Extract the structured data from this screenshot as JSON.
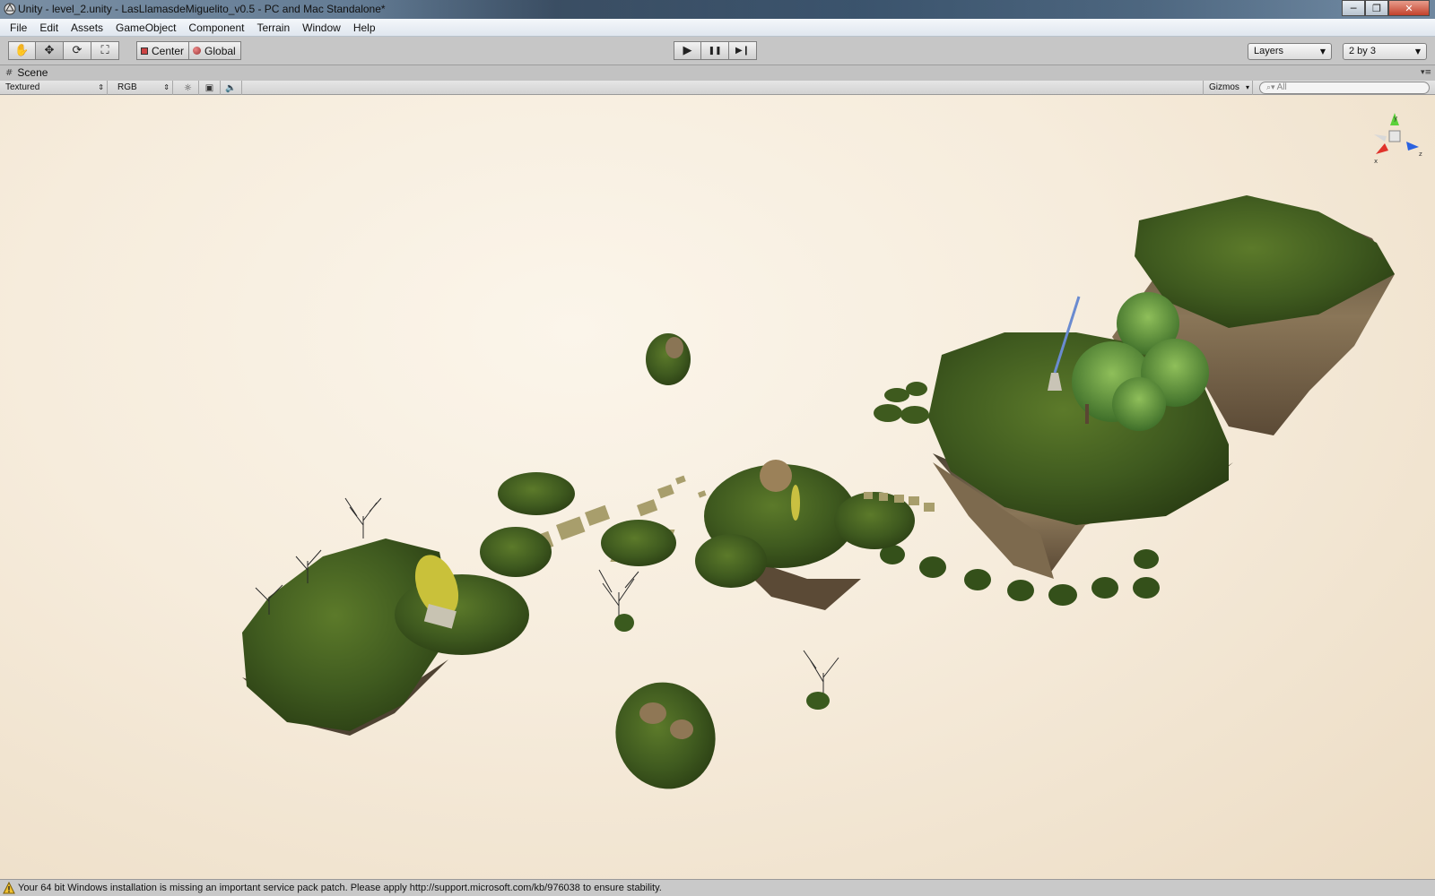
{
  "window": {
    "title": "Unity - level_2.unity - LasLlamasdeMiguelito_v0.5 - PC and Mac Standalone*",
    "minimize_glyph": "─",
    "restore_glyph": "❐",
    "close_glyph": "✕"
  },
  "menu": {
    "items": [
      "File",
      "Edit",
      "Assets",
      "GameObject",
      "Component",
      "Terrain",
      "Window",
      "Help"
    ]
  },
  "toolbar": {
    "tools": [
      {
        "name": "hand-tool",
        "icon": "hand-icon",
        "glyph": "✋",
        "active": false
      },
      {
        "name": "move-tool",
        "icon": "move-icon",
        "glyph": "✥",
        "active": true
      },
      {
        "name": "rotate-tool",
        "icon": "rotate-icon",
        "glyph": "⟳",
        "active": false
      },
      {
        "name": "scale-tool",
        "icon": "scale-icon",
        "glyph": "⛶",
        "active": false
      }
    ],
    "pivot_mode_label": "Center",
    "pivot_rotation_label": "Global",
    "play_glyph": "▶",
    "pause_glyph": "❚❚",
    "step_glyph": "▶❙",
    "layers_label": "Layers",
    "layout_label": "2 by 3"
  },
  "scene": {
    "tab_label": "Scene",
    "render_mode": "Textured",
    "color_mode": "RGB",
    "gizmos_label": "Gizmos",
    "search_placeholder": "All",
    "gizmo_axes": {
      "y": "y",
      "x": "x",
      "z": "z"
    }
  },
  "status": {
    "message": "Your 64 bit Windows installation is missing an important service pack patch. Please apply http://support.microsoft.com/kb/976038 to ensure stability."
  },
  "colors": {
    "grass": "#3f5a1f",
    "rock": "#6b5a44",
    "sky": "#f6ecdc",
    "gizmo_y": "#5bd23a",
    "gizmo_x": "#e0332b",
    "gizmo_z": "#2b62e0"
  }
}
